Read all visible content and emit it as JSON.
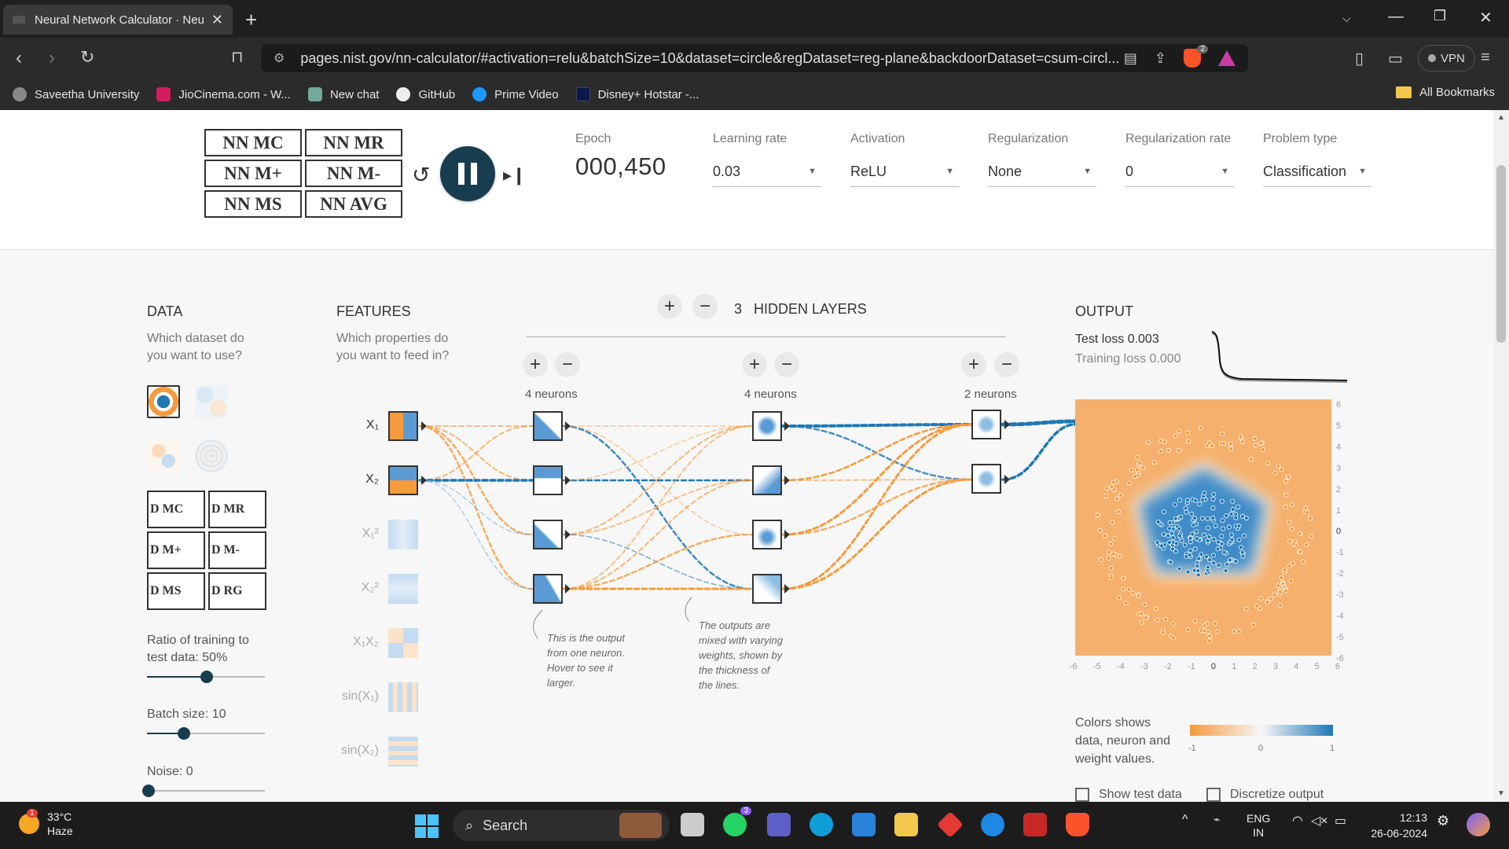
{
  "browser": {
    "tab_title": "Neural Network Calculator · Neu",
    "url": "pages.nist.gov/nn-calculator/#activation=relu&batchSize=10&dataset=circle&regDataset=reg-plane&backdoorDataset=csum-circl...",
    "brave_badge": "2",
    "vpn_label": "VPN",
    "bookmarks": [
      {
        "label": "Saveetha University",
        "color": "#888"
      },
      {
        "label": "JioCinema.com - W...",
        "color": "#d81b60"
      },
      {
        "label": "New chat",
        "color": "#74aa9c"
      },
      {
        "label": "GitHub",
        "color": "#eee"
      },
      {
        "label": "Prime Video",
        "color": "#1a98ff"
      },
      {
        "label": "Disney+ Hotstar -...",
        "color": "#0c1a4b"
      }
    ],
    "all_bookmarks": "All Bookmarks"
  },
  "calculator": {
    "buttons": [
      "NN MC",
      "NN MR",
      "NN M+",
      "NN M-",
      "NN MS",
      "NN AVG"
    ]
  },
  "controls": {
    "epoch_label": "Epoch",
    "epoch_value": "000,450",
    "learning_rate_label": "Learning rate",
    "learning_rate_value": "0.03",
    "activation_label": "Activation",
    "activation_value": "ReLU",
    "regularization_label": "Regularization",
    "regularization_value": "None",
    "reg_rate_label": "Regularization rate",
    "reg_rate_value": "0",
    "problem_type_label": "Problem type",
    "problem_type_value": "Classification"
  },
  "data_panel": {
    "title": "DATA",
    "subtitle_1": "Which dataset do",
    "subtitle_2": "you want to use?",
    "buttons": [
      "D MC",
      "D MR",
      "D M+",
      "D M-",
      "D MS",
      "D RG"
    ],
    "ratio_label_1": "Ratio of training to",
    "ratio_label_2": "test data:  50%",
    "ratio_value": 0.5,
    "batch_label": "Batch size:  10",
    "batch_value": 10,
    "noise_label": "Noise:  0",
    "noise_value": 0
  },
  "features_panel": {
    "title": "FEATURES",
    "subtitle_1": "Which properties do",
    "subtitle_2": "you want to feed in?",
    "features": [
      {
        "label": "X₁",
        "active": true
      },
      {
        "label": "X₂",
        "active": true
      },
      {
        "label": "X₁²",
        "active": false
      },
      {
        "label": "X₂²",
        "active": false
      },
      {
        "label": "X₁X₂",
        "active": false
      },
      {
        "label": "sin(X₁)",
        "active": false
      },
      {
        "label": "sin(X₂)",
        "active": false
      }
    ]
  },
  "network": {
    "layer_count": "3",
    "hidden_layers_label": "HIDDEN LAYERS",
    "layers": [
      {
        "neurons_label": "4 neurons"
      },
      {
        "neurons_label": "4 neurons"
      },
      {
        "neurons_label": "2 neurons"
      }
    ],
    "note_1": [
      "This is the output",
      "from one neuron.",
      "Hover to see it",
      "larger."
    ],
    "note_2": [
      "The outputs are",
      "mixed with varying",
      "weights, shown by",
      "the thickness of",
      "the lines."
    ]
  },
  "output_panel": {
    "title": "OUTPUT",
    "test_loss": "Test loss 0.003",
    "training_loss": "Training loss 0.000",
    "y_ticks": [
      "6",
      "5",
      "4",
      "3",
      "2",
      "1",
      "0",
      "-1",
      "-2",
      "-3",
      "-4",
      "-5",
      "-6"
    ],
    "x_ticks": [
      "-6",
      "-5",
      "-4",
      "-3",
      "-2",
      "-1",
      "0",
      "1",
      "2",
      "3",
      "4",
      "5",
      "6"
    ],
    "legend_text_1": "Colors shows",
    "legend_text_2": "data, neuron and",
    "legend_text_3": "weight values.",
    "legend_min": "-1",
    "legend_mid": "0",
    "legend_max": "1",
    "show_test_data": "Show test data",
    "discretize_output": "Discretize output",
    "colors": {
      "negative": "#f59b3d",
      "positive": "#1f78b4"
    }
  },
  "taskbar": {
    "temperature": "33°C",
    "weather": "Haze",
    "weather_badge": "1",
    "search_placeholder": "Search",
    "whatsapp_badge": "3",
    "lang_1": "ENG",
    "lang_2": "IN",
    "time": "12:13",
    "date": "26-06-2024"
  }
}
